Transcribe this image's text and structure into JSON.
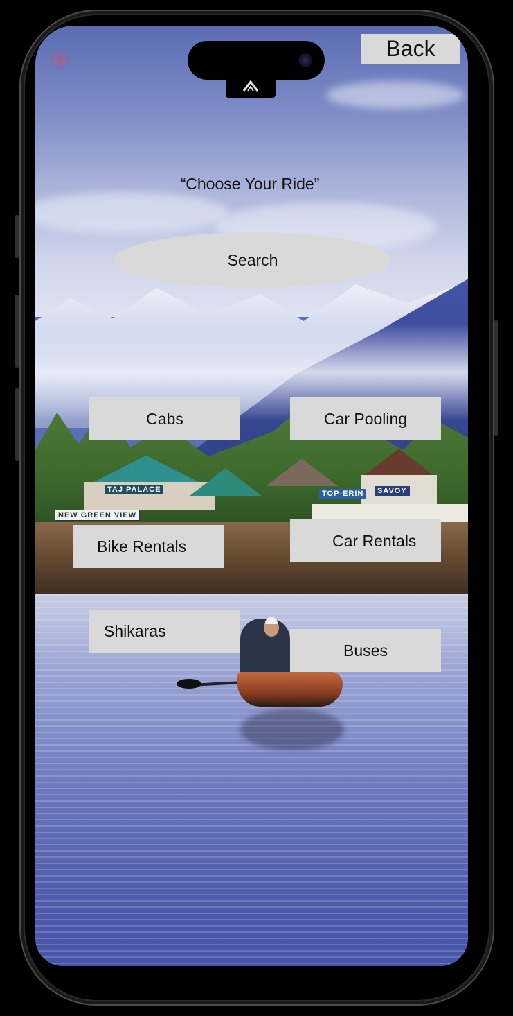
{
  "header": {
    "back_label": "Back",
    "logo_glyph": "⋏"
  },
  "main": {
    "title": "“Choose Your Ride”",
    "search_placeholder": "Search",
    "options": [
      {
        "label": "Cabs"
      },
      {
        "label": "Car Pooling"
      },
      {
        "label": "Bike Rentals"
      },
      {
        "label": "Car Rentals"
      },
      {
        "label": "Shikaras"
      },
      {
        "label": "Buses"
      }
    ]
  },
  "background": {
    "signs": [
      "TAJ PALACE",
      "NEW GREEN VIEW",
      "TOP-ERIN",
      "SAVOY"
    ]
  },
  "colors": {
    "button_bg": "#d9d9d9",
    "text": "#111111",
    "sky": "#5b6cb4",
    "water": "#4e5cae"
  }
}
